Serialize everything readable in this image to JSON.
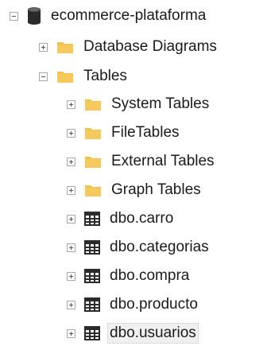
{
  "tree": {
    "root": {
      "label": "ecommerce-plataforma",
      "state": "expanded"
    },
    "diagrams": {
      "label": "Database Diagrams",
      "state": "collapsed"
    },
    "tables": {
      "label": "Tables",
      "state": "expanded"
    },
    "folders": [
      {
        "label": "System Tables",
        "state": "collapsed"
      },
      {
        "label": "FileTables",
        "state": "collapsed"
      },
      {
        "label": "External Tables",
        "state": "collapsed"
      },
      {
        "label": "Graph Tables",
        "state": "collapsed"
      }
    ],
    "table_items": [
      {
        "label": "dbo.carro",
        "state": "collapsed"
      },
      {
        "label": "dbo.categorias",
        "state": "collapsed"
      },
      {
        "label": "dbo.compra",
        "state": "collapsed"
      },
      {
        "label": "dbo.producto",
        "state": "collapsed"
      },
      {
        "label": "dbo.usuarios",
        "state": "collapsed",
        "selected": true
      }
    ]
  },
  "colors": {
    "folder": "#f2c24f",
    "database": "#2b2b2b",
    "selection": "#f0f0f0"
  }
}
